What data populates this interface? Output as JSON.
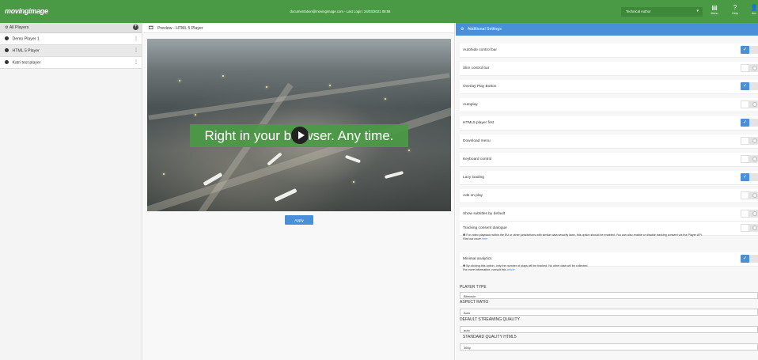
{
  "topbar": {
    "logo": "movingimage",
    "login_info": "documentation@movingimage.com - Last Login: 24/03/2021 08:58",
    "role": "Technical Author",
    "icons": [
      {
        "name": "menu-icon",
        "glyph": "▤",
        "label": "Menu"
      },
      {
        "name": "help-icon",
        "glyph": "?",
        "label": "Help"
      },
      {
        "name": "account-icon",
        "glyph": "👤",
        "label": "Acc"
      }
    ]
  },
  "sidebar": {
    "header": "All Players",
    "items": [
      {
        "label": "Demo Player 1",
        "active": false
      },
      {
        "label": "HTML 5 Player",
        "active": true
      },
      {
        "label": "Katri test player",
        "active": false
      }
    ]
  },
  "preview": {
    "title": "Preview - HTML 5 Player",
    "overlay_text": "Right in your browser. Any time.",
    "apply_label": "Apply"
  },
  "settings": {
    "title": "Additional Settings",
    "toggles": [
      {
        "label": "Autohide control bar",
        "on": true
      },
      {
        "label": "Slim control bar",
        "on": false
      },
      {
        "label": "Overlay Play Button",
        "on": true
      },
      {
        "label": "Autoplay",
        "on": false
      },
      {
        "label": "HTML5 player first",
        "on": true
      },
      {
        "label": "Download menu",
        "on": false
      },
      {
        "label": "Keyboard control",
        "on": false
      },
      {
        "label": "Lazy loading",
        "on": true
      },
      {
        "label": "Ads on play",
        "on": false
      },
      {
        "label": "Show subtitles by default",
        "on": false
      },
      {
        "label": "Tracking consent dialogue",
        "on": false
      },
      {
        "label": "Minimal analytics",
        "on": true
      }
    ],
    "tracking_note": "For video playback within the EU or other jurisdictions with similar data security laws, this option should be enabled. You can also enable or disable tracking consent via the Player API.",
    "tracking_more_prefix": "Find out more ",
    "tracking_more_link": "here",
    "analytics_note": "By clicking this option, only the number of plays will be tracked. No other data will be collected.",
    "analytics_more_prefix": "For more information, consult this ",
    "analytics_more_link": "article",
    "player_type_label": "PLAYER TYPE",
    "player_type_value": "Bitmovin",
    "aspect_ratio_label": "ASPECT RATIO",
    "aspect_ratio_value": "Auto",
    "streaming_quality_label": "DEFAULT STREAMING QUALITY",
    "streaming_quality_value": "auto",
    "html5_quality_label": "STANDARD QUALITY HTML5",
    "html5_quality_value": "360p"
  },
  "colors": {
    "brand_green": "#4a9a45",
    "accent_blue": "#4a90d9"
  }
}
